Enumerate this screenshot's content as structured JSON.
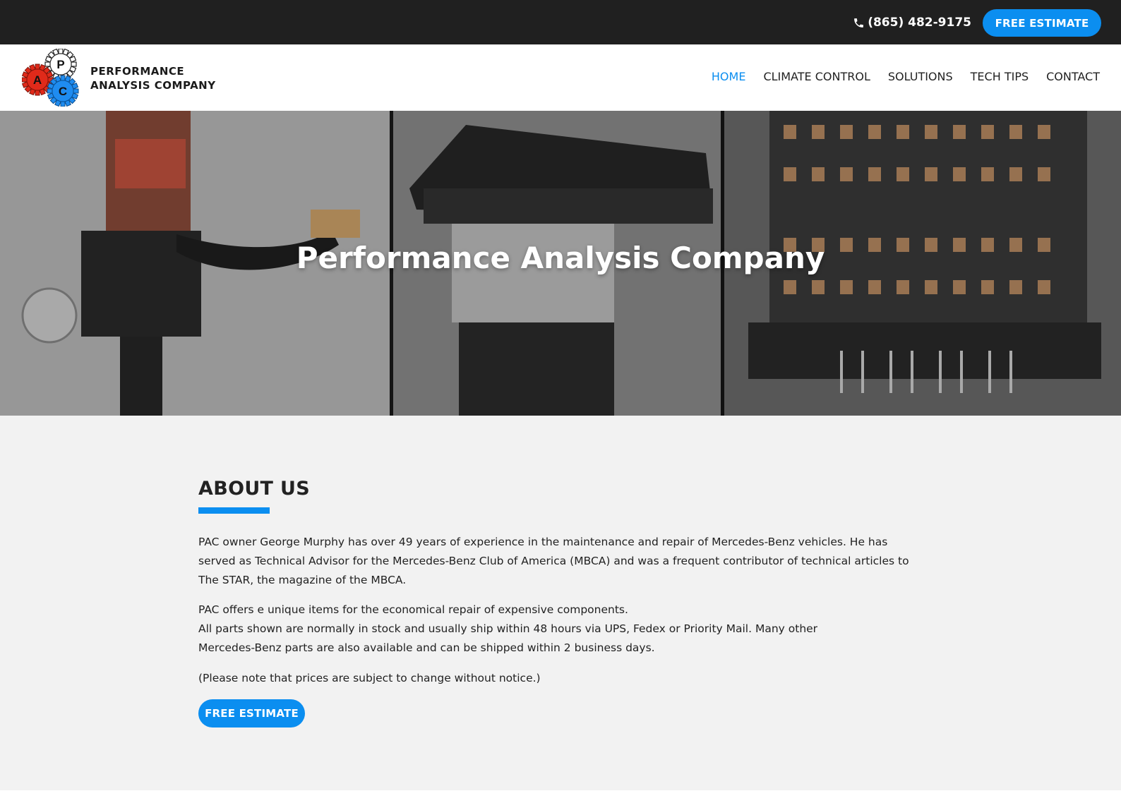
{
  "topbar": {
    "phone": "(865) 482-9175",
    "phone_icon": "phone-icon",
    "cta_label": "FREE ESTIMATE"
  },
  "header": {
    "logo_letters": [
      "A",
      "P",
      "C"
    ],
    "brand_line1": "PERFORMANCE",
    "brand_line2": "ANALYSIS COMPANY",
    "nav": [
      {
        "label": "HOME",
        "active": true
      },
      {
        "label": "CLIMATE CONTROL",
        "active": false
      },
      {
        "label": "SOLUTIONS",
        "active": false
      },
      {
        "label": "TECH TIPS",
        "active": false
      },
      {
        "label": "CONTACT",
        "active": false
      }
    ]
  },
  "hero": {
    "title": "Performance Analysis Company"
  },
  "about": {
    "title": "ABOUT US",
    "paragraph1": "PAC owner George Murphy has over 49 years of experience in the maintenance and repair of Mercedes-Benz vehicles. He has served as Technical Advisor for the Mercedes-Benz Club of America (MBCA) and was a frequent contributor of technical articles to The STAR, the magazine of the MBCA.",
    "paragraph2a": "PAC offers e unique items for the economical repair of expensive components.",
    "paragraph2b": "All parts shown are normally in stock and usually ship within 48 hours via UPS, Fedex or Priority Mail. Many other Mercedes-Benz parts are also available and can be shipped within 2 business days.",
    "paragraph3": "(Please note that prices are subject to change without notice.)",
    "cta_label": "FREE ESTIMATE"
  },
  "colors": {
    "accent": "#0b8ef0",
    "topbar": "#202020",
    "gear_red": "#e02a1a",
    "gear_blue": "#1f8cf0"
  }
}
